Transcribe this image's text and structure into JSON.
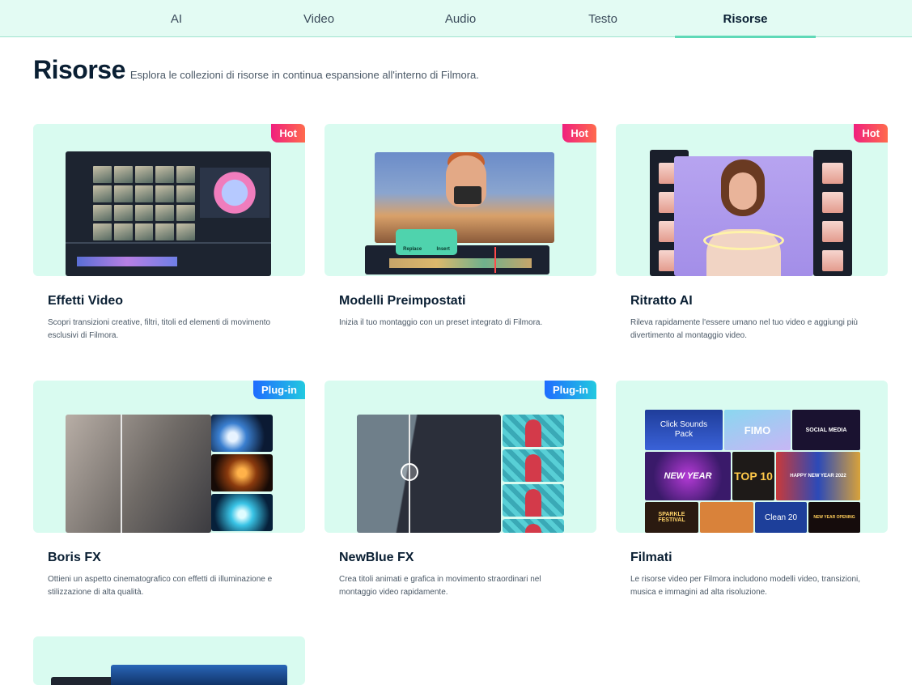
{
  "tabs": [
    {
      "label": "AI",
      "active": false
    },
    {
      "label": "Video",
      "active": false
    },
    {
      "label": "Audio",
      "active": false
    },
    {
      "label": "Testo",
      "active": false
    },
    {
      "label": "Risorse",
      "active": true
    }
  ],
  "header": {
    "title": "Risorse",
    "subtitle": "Esplora le collezioni di risorse in continua espansione all'interno di Filmora."
  },
  "cards": [
    {
      "badge": "Hot",
      "title": "Effetti Video",
      "description": "Scopri transizioni creative, filtri, titoli ed elementi di movimento esclusivi di Filmora."
    },
    {
      "badge": "Hot",
      "title": "Modelli Preimpostati",
      "description": "Inizia il tuo montaggio con un preset integrato di Filmora.",
      "thumbnail_text": {
        "replace": "Replace",
        "insert": "Insert"
      }
    },
    {
      "badge": "Hot",
      "title": "Ritratto AI",
      "description": "Rileva rapidamente l'essere umano nel tuo video e aggiungi più divertimento al montaggio video."
    },
    {
      "badge": "Plug-in",
      "title": "Boris FX",
      "description": "Ottieni un aspetto cinematografico con effetti di illuminazione e stilizzazione di alta qualità."
    },
    {
      "badge": "Plug-in",
      "title": "NewBlue FX",
      "description": "Crea titoli animati e grafica in movimento straordinari nel montaggio video rapidamente."
    },
    {
      "badge": "",
      "title": "Filmati",
      "description": "Le risorse video per Filmora includono modelli video, transizioni, musica e immagini ad alta risoluzione.",
      "thumbnail_text": {
        "click_sounds": "Click Sounds",
        "pack": "Pack",
        "fimo": "FIMO",
        "social_media": "SOCIAL MEDIA",
        "new_year": "NEW YEAR",
        "top10": "TOP 10",
        "happy_new_year": "HAPPY NEW YEAR 2022",
        "sparkle": "SPARKLE FESTIVAL",
        "clean": "Clean 20",
        "new_year_opening": "NEW YEAR OPENING"
      }
    }
  ],
  "colors": {
    "tabbar_bg": "#e3fbf3",
    "card_bg": "#d9fbf0",
    "active_underline": "#5fd9b7",
    "badge_hot": "#f0207e",
    "badge_plugin": "#1e6cff"
  }
}
